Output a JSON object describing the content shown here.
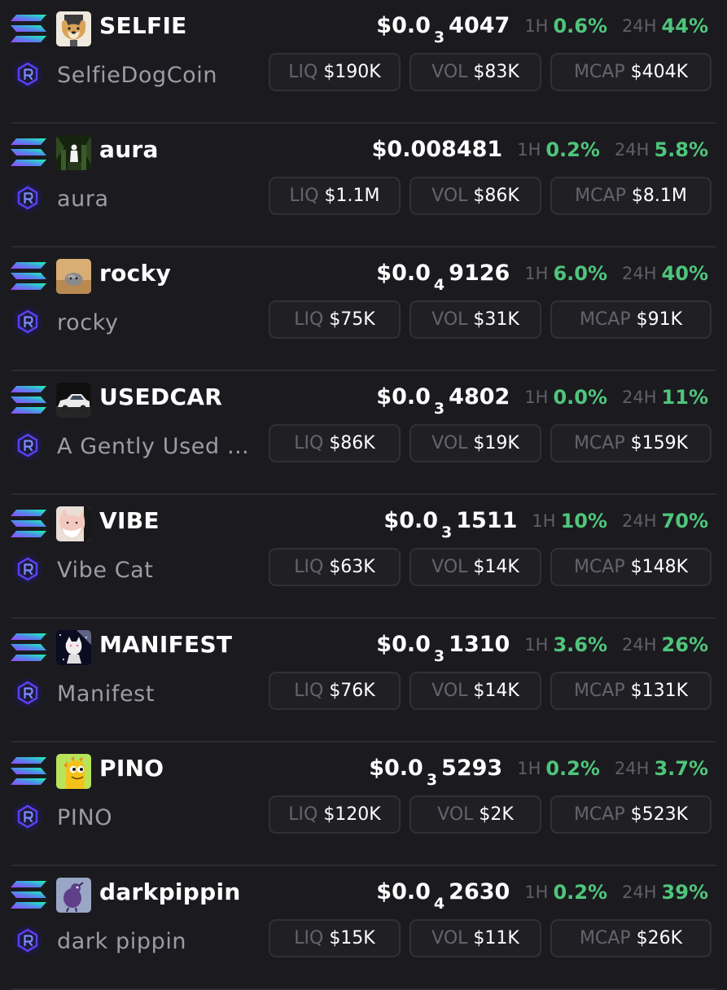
{
  "colors": {
    "background": "#1b1b1f",
    "positive": "#4fc57b",
    "muted_label": "#5e5e66",
    "pill_border": "#303036",
    "dex_ring": "#5b3ff0"
  },
  "labels": {
    "h1": "1H",
    "h24": "24H",
    "liq": "LIQ",
    "vol": "VOL",
    "mcap": "MCAP"
  },
  "tokens": [
    {
      "symbol": "SELFIE",
      "name": "SelfieDogCoin",
      "avatar_icon": "dog-selfie-avatar-icon",
      "price": {
        "prefix": "$0.0",
        "zeros": "3",
        "digits": "4047"
      },
      "change_1h": "0.6%",
      "change_24h": "44%",
      "liq": "$190K",
      "vol": "$83K",
      "mcap": "$404K"
    },
    {
      "symbol": "aura",
      "name": "aura",
      "avatar_icon": "forest-figure-avatar-icon",
      "price": {
        "prefix": "$0.008481",
        "zeros": "",
        "digits": ""
      },
      "change_1h": "0.2%",
      "change_24h": "5.8%",
      "liq": "$1.1M",
      "vol": "$86K",
      "mcap": "$8.1M"
    },
    {
      "symbol": "rocky",
      "name": "rocky",
      "avatar_icon": "rock-avatar-icon",
      "price": {
        "prefix": "$0.0",
        "zeros": "4",
        "digits": "9126"
      },
      "change_1h": "6.0%",
      "change_24h": "40%",
      "liq": "$75K",
      "vol": "$31K",
      "mcap": "$91K"
    },
    {
      "symbol": "USEDCAR",
      "name": "A Gently Used Car",
      "avatar_icon": "car-avatar-icon",
      "price": {
        "prefix": "$0.0",
        "zeros": "3",
        "digits": "4802"
      },
      "change_1h": "0.0%",
      "change_24h": "11%",
      "liq": "$86K",
      "vol": "$19K",
      "mcap": "$159K"
    },
    {
      "symbol": "VIBE",
      "name": "Vibe Cat",
      "avatar_icon": "cat-avatar-icon",
      "price": {
        "prefix": "$0.0",
        "zeros": "3",
        "digits": "1511"
      },
      "change_1h": "10%",
      "change_24h": "70%",
      "liq": "$63K",
      "vol": "$14K",
      "mcap": "$148K"
    },
    {
      "symbol": "MANIFEST",
      "name": "Manifest",
      "avatar_icon": "space-cat-avatar-icon",
      "price": {
        "prefix": "$0.0",
        "zeros": "3",
        "digits": "1310"
      },
      "change_1h": "3.6%",
      "change_24h": "26%",
      "liq": "$76K",
      "vol": "$14K",
      "mcap": "$131K"
    },
    {
      "symbol": "PINO",
      "name": "PINO",
      "avatar_icon": "yellow-dino-avatar-icon",
      "price": {
        "prefix": "$0.0",
        "zeros": "3",
        "digits": "5293"
      },
      "change_1h": "0.2%",
      "change_24h": "3.7%",
      "liq": "$120K",
      "vol": "$2K",
      "mcap": "$523K"
    },
    {
      "symbol": "darkpippin",
      "name": "dark pippin",
      "avatar_icon": "purple-bird-avatar-icon",
      "price": {
        "prefix": "$0.0",
        "zeros": "4",
        "digits": "2630"
      },
      "change_1h": "0.2%",
      "change_24h": "39%",
      "liq": "$15K",
      "vol": "$11K",
      "mcap": "$26K"
    }
  ]
}
